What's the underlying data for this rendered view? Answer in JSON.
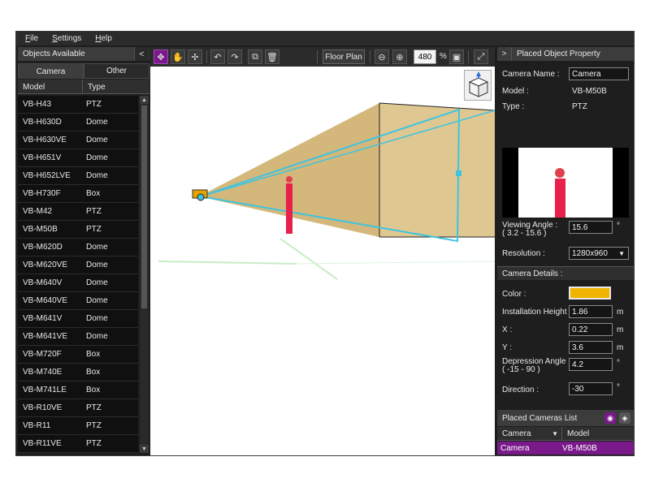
{
  "menu": [
    "File",
    "Settings",
    "Help"
  ],
  "left_panel": {
    "title": "Objects Available",
    "collapse": "<",
    "tabs": [
      "Camera",
      "Other"
    ],
    "columns": [
      "Model",
      "Type"
    ],
    "rows": [
      {
        "model": "VB-H43",
        "type": "PTZ"
      },
      {
        "model": "VB-H630D",
        "type": "Dome"
      },
      {
        "model": "VB-H630VE",
        "type": "Dome"
      },
      {
        "model": "VB-H651V",
        "type": "Dome"
      },
      {
        "model": "VB-H652LVE",
        "type": "Dome"
      },
      {
        "model": "VB-H730F",
        "type": "Box"
      },
      {
        "model": "VB-M42",
        "type": "PTZ"
      },
      {
        "model": "VB-M50B",
        "type": "PTZ"
      },
      {
        "model": "VB-M620D",
        "type": "Dome"
      },
      {
        "model": "VB-M620VE",
        "type": "Dome"
      },
      {
        "model": "VB-M640V",
        "type": "Dome"
      },
      {
        "model": "VB-M640VE",
        "type": "Dome"
      },
      {
        "model": "VB-M641V",
        "type": "Dome"
      },
      {
        "model": "VB-M641VE",
        "type": "Dome"
      },
      {
        "model": "VB-M720F",
        "type": "Box"
      },
      {
        "model": "VB-M740E",
        "type": "Box"
      },
      {
        "model": "VB-M741LE",
        "type": "Box"
      },
      {
        "model": "VB-R10VE",
        "type": "PTZ"
      },
      {
        "model": "VB-R11",
        "type": "PTZ"
      },
      {
        "model": "VB-R11VE",
        "type": "PTZ"
      }
    ]
  },
  "toolbar": {
    "floor_plan": "Floor Plan",
    "zoom_value": "480",
    "zoom_unit": "%"
  },
  "property": {
    "title": "Placed Object Property",
    "arrow": ">",
    "camera_name_label": "Camera Name :",
    "camera_name": "Camera",
    "model_label": "Model :",
    "model": "VB-M50B",
    "type_label": "Type :",
    "type": "PTZ",
    "viewing_angle_label": "Viewing Angle :",
    "viewing_angle_range": "( 3.2  -  15.6 )",
    "viewing_angle": "15.6",
    "degree": "°",
    "resolution_label": "Resolution :",
    "resolution": "1280x960",
    "camera_details": "Camera Details :",
    "color_label": "Color :",
    "color": "#f0b400",
    "install_height_label": "Installation Height :",
    "install_height": "1.86",
    "x_label": "X :",
    "x": "0.22",
    "y_label": "Y :",
    "y": "3.6",
    "unit_m": "m",
    "depression_label": "Depression Angle :",
    "depression_range": "( -15  -  90 )",
    "depression": "4.2",
    "direction_label": "Direction :",
    "direction": "-30"
  },
  "placed_list": {
    "title": "Placed Cameras List",
    "columns": [
      "Camera",
      "Model"
    ],
    "rows": [
      {
        "camera": "Camera",
        "model": "VB-M50B"
      }
    ]
  }
}
